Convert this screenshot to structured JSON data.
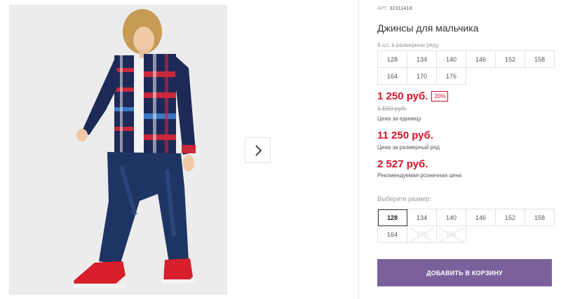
{
  "product": {
    "sku_label": "АРТ.",
    "sku": "32311418",
    "title": "Джинсы для мальчика",
    "sizes_note": "9 шт. в размерном ряду",
    "size_range": [
      "128",
      "134",
      "140",
      "146",
      "152",
      "158",
      "164",
      "170",
      "176"
    ]
  },
  "pricing": {
    "unit_price": "1 250 руб.",
    "discount": "20%",
    "old_price": "1 560 руб.",
    "unit_label": "Цена за единицу",
    "range_price": "11 250 руб.",
    "range_label": "Цена за размерный ряд",
    "retail_price": "2 527 руб.",
    "retail_label": "Рекомендуемая розничная цена"
  },
  "size_picker": {
    "label": "Выберите размер:",
    "selected": "128",
    "options": [
      {
        "size": "128",
        "available": true
      },
      {
        "size": "134",
        "available": true
      },
      {
        "size": "140",
        "available": true
      },
      {
        "size": "146",
        "available": true
      },
      {
        "size": "152",
        "available": true
      },
      {
        "size": "158",
        "available": true
      },
      {
        "size": "164",
        "available": true
      },
      {
        "size": "170",
        "available": false
      },
      {
        "size": "176",
        "available": false
      }
    ]
  },
  "actions": {
    "add_to_cart": "ДОБАВИТЬ В КОРЗИНУ"
  },
  "gallery": {
    "next_icon": "chevron-right-icon"
  },
  "colors": {
    "price_red": "#d4142a",
    "button_purple": "#7a619c"
  }
}
